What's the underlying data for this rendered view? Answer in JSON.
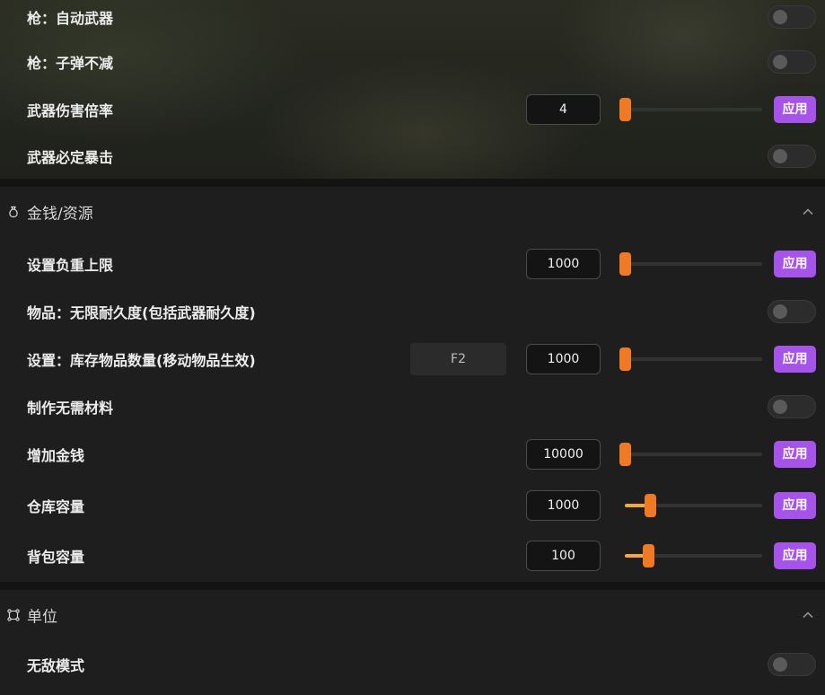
{
  "weapons_rows": [
    {
      "label": "枪：自动武器",
      "type": "toggle"
    },
    {
      "label": "枪：子弹不减",
      "type": "toggle"
    },
    {
      "label": "武器伤害倍率",
      "type": "slider",
      "value": "4",
      "slider_fraction": 0.0,
      "apply": "应用"
    },
    {
      "label": "武器必定暴击",
      "type": "toggle"
    }
  ],
  "money_section": {
    "icon": "money-bag-icon",
    "title": "金钱/资源",
    "rows": [
      {
        "label": "设置负重上限",
        "type": "slider",
        "value": "1000",
        "slider_fraction": 0.0,
        "apply": "应用"
      },
      {
        "label": "物品：无限耐久度(包括武器耐久度)",
        "type": "toggle"
      },
      {
        "label": "设置：库存物品数量(移动物品生效)",
        "type": "slider",
        "hotkey": "F2",
        "value": "1000",
        "slider_fraction": 0.0,
        "apply": "应用"
      },
      {
        "label": "制作无需材料",
        "type": "toggle"
      },
      {
        "label": "增加金钱",
        "type": "slider",
        "value": "10000",
        "slider_fraction": 0.0,
        "apply": "应用"
      },
      {
        "label": "仓库容量",
        "type": "slider",
        "value": "1000",
        "slider_fraction": 0.18,
        "apply": "应用"
      },
      {
        "label": "背包容量",
        "type": "slider",
        "value": "100",
        "slider_fraction": 0.17,
        "apply": "应用"
      }
    ]
  },
  "unit_section": {
    "icon": "unit-nodes-icon",
    "title": "单位",
    "rows": [
      {
        "label": "无敌模式",
        "type": "toggle"
      }
    ]
  },
  "colors": {
    "accent_button": "#a653ea",
    "slider_thumb": "#f07a24",
    "slider_fill": "#f5a640"
  }
}
